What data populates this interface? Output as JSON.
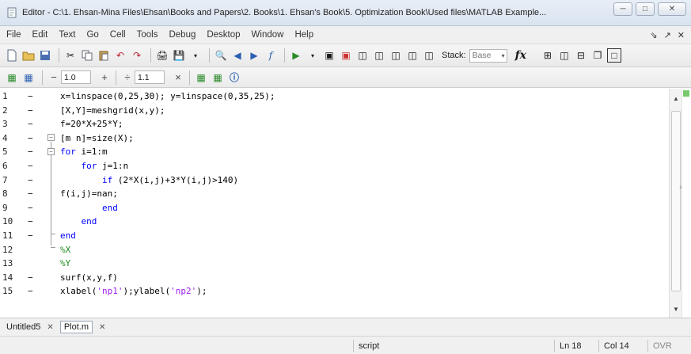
{
  "window": {
    "title": "Editor - C:\\1. Ehsan-Mina Files\\Ehsan\\Books and Papers\\2. Books\\1. Ehsan's Book\\5. Optimization Book\\Used files\\MATLAB Example...",
    "controls": [
      "minimize",
      "maximize",
      "close"
    ]
  },
  "menu": {
    "items": [
      "File",
      "Edit",
      "Text",
      "Go",
      "Cell",
      "Tools",
      "Debug",
      "Desktop",
      "Window",
      "Help"
    ],
    "right": [
      "⇘",
      "↗",
      "✕"
    ]
  },
  "toolbar": {
    "stack_label": "Stack:",
    "stack_value": "Base",
    "fx_label": "fx"
  },
  "cell_toolbar": {
    "minus": "−",
    "value1": "1.0",
    "plus": "+",
    "divide": "÷",
    "value2": "1.1",
    "times": "×"
  },
  "code": {
    "lines": [
      {
        "num": "1",
        "dash": true,
        "text": "x=linspace(0,25,30); y=linspace(0,35,25);"
      },
      {
        "num": "2",
        "dash": true,
        "text": "[X,Y]=meshgrid(x,y);"
      },
      {
        "num": "3",
        "dash": true,
        "text": "f=20*X+25*Y;"
      },
      {
        "num": "4",
        "dash": true,
        "text": "[m n]=size(X);"
      },
      {
        "num": "5",
        "dash": true,
        "text": "for i=1:m"
      },
      {
        "num": "6",
        "dash": true,
        "text": "    for j=1:n"
      },
      {
        "num": "7",
        "dash": true,
        "text": "        if (2*X(i,j)+3*Y(i,j)>140)"
      },
      {
        "num": "8",
        "dash": true,
        "text": "f(i,j)=nan;"
      },
      {
        "num": "9",
        "dash": true,
        "text": "        end"
      },
      {
        "num": "10",
        "dash": true,
        "text": "    end"
      },
      {
        "num": "11",
        "dash": true,
        "text": "end"
      },
      {
        "num": "12",
        "dash": false,
        "text": "%X"
      },
      {
        "num": "13",
        "dash": false,
        "text": "%Y"
      },
      {
        "num": "14",
        "dash": true,
        "text": "surf(x,y,f)"
      },
      {
        "num": "15",
        "dash": true,
        "text": "xlabel('np1');ylabel('np2');"
      }
    ]
  },
  "tabs": [
    {
      "label": "Untitled5",
      "active": false
    },
    {
      "label": "Plot.m",
      "active": true
    }
  ],
  "status": {
    "mode": "script",
    "line": "Ln  18",
    "col": "Col  14",
    "ovr": "OVR"
  },
  "colors": {
    "keyword": "#0000ff",
    "string": "#a020f0",
    "comment": "#228b22"
  }
}
